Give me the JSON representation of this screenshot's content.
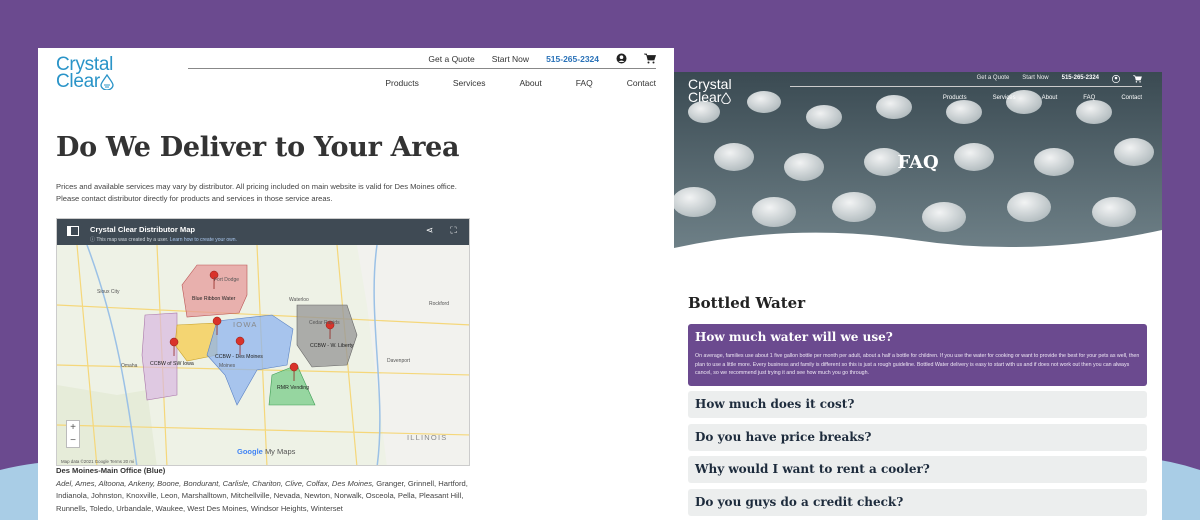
{
  "left": {
    "logo": {
      "line1": "Crystal",
      "line2": "Clear"
    },
    "header": {
      "quote": "Get a Quote",
      "start": "Start Now",
      "phone": "515-265-2324"
    },
    "nav": [
      "Products",
      "Services",
      "About",
      "FAQ",
      "Contact"
    ],
    "title": "Do We Deliver to Your Area",
    "intro": "Prices and available services may vary by distributor. All pricing included on main website is valid for Des Moines office. Please contact distributor directly for products and services in those service areas.",
    "map": {
      "title": "Crystal Clear Distributor Map",
      "sub_prefix": "This map was created by a user.",
      "sub_link": "Learn how to create your own.",
      "regions": [
        "Blue Ribbon Water",
        "CCBW of SW Iowa",
        "CCBW - Des Moines",
        "CCBW - W. Liberty",
        "RMR Vending"
      ],
      "cities": [
        "Sioux City",
        "Fort Dodge",
        "Waterloo",
        "Cedar Rapids",
        "Omaha",
        "Davenport",
        "Rockford",
        "Moines"
      ],
      "states": [
        "IOWA",
        "ILLINOIS"
      ],
      "zoom_in": "+",
      "zoom_out": "−",
      "brand_google": "Google",
      "brand_maps": "My Maps",
      "footer": "Map data ©2021 Google    Terms    20 mi"
    },
    "office_title": "Des Moines-Main Office (Blue)",
    "office_italic": "Adel, Ames, Altoona, Ankeny, Boone, Bondurant, Carlisle, Chariton, Clive, Colfax, Des Moines,",
    "office_rest": " Granger, Grinnell, Hartford, Indianola, Johnston, Knoxville, Leon, Marshalltown, Mitchellville, Nevada, Newton, Norwalk, Osceola, Pella, Pleasant Hill, Runnells, Toledo, Urbandale, Waukee, West Des Moines, Windsor Heights, Winterset"
  },
  "right": {
    "logo": {
      "line1": "Crystal",
      "line2": "Clear"
    },
    "header": {
      "quote": "Get a Quote",
      "start": "Start Now",
      "phone": "515-265-2324"
    },
    "nav": [
      "Products",
      "Services",
      "About",
      "FAQ",
      "Contact"
    ],
    "hero_title": "FAQ",
    "section_title": "Bottled Water",
    "faqs": [
      {
        "q": "How much water will we use?",
        "a": "On average, families use about 1 five gallon bottle per month per adult, about a half a bottle for children. If you use the water for cooking or want to provide the best for your pets as well, then plan to use a little more. Every business and family is different so this is just a rough guideline. Bottled Water delivery is easy to start with us and if does not work out then you can always cancel, so we recommend just trying it and see how much you go through."
      },
      {
        "q": "How much does it cost?"
      },
      {
        "q": "Do you have price breaks?"
      },
      {
        "q": "Why would I want to rent a cooler?"
      },
      {
        "q": "Do you guys do a credit check?"
      }
    ]
  },
  "colors": {
    "background": "#6b4a8f",
    "brand_blue": "#2a94c8",
    "accordion_open": "#6b4a8f",
    "accordion_closed": "#eceeee"
  }
}
